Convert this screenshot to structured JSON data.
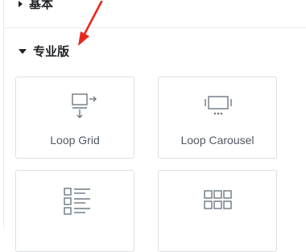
{
  "sections": {
    "basic": {
      "label": "基本"
    },
    "pro": {
      "label": "专业版"
    }
  },
  "widgets": [
    {
      "label": "Loop Grid",
      "icon": "loop-grid-icon"
    },
    {
      "label": "Loop Carousel",
      "icon": "loop-carousel-icon"
    },
    {
      "label": "",
      "icon": "posts-list-icon"
    },
    {
      "label": "",
      "icon": "gallery-grid-icon"
    }
  ],
  "annotation": {
    "arrow_color": "#e8271c"
  },
  "colors": {
    "text": "#1f2124",
    "widget_label": "#515962",
    "border": "#dcdfe3",
    "icon": "#6d7882"
  }
}
